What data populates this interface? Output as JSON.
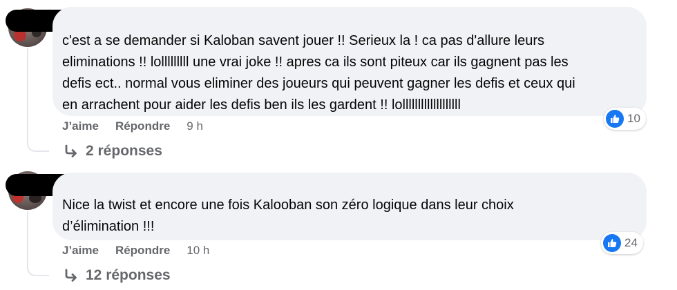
{
  "comments": [
    {
      "text_lines": [
        "c'est a se demander si Kaloban savent jouer !! Serieux la ! ca pas d'allure leurs",
        "eliminations !! lolllllllll une vrai joke !! apres ca ils sont piteux car ils gagnent pas les",
        "defis ect.. normal vous eliminer des joueurs qui peuvent gagner les defis et ceux qui",
        "en arrachent pour aider les defis ben ils les gardent !! lolllllllllllllllllll"
      ],
      "like_label": "J’aime",
      "reply_label": "Répondre",
      "time": "9 h",
      "reaction_count": "10",
      "replies_label": "2 réponses"
    },
    {
      "text_lines": [
        "Nice la twist et encore une fois Kalooban son zéro logique dans leur choix",
        "d’élimination !!!"
      ],
      "like_label": "J’aime",
      "reply_label": "Répondre",
      "time": "10 h",
      "reaction_count": "24",
      "replies_label": "12 réponses"
    }
  ],
  "colors": {
    "bubble_bg": "#f0f2f5",
    "secondary_text": "#65676b",
    "like_blue": "#1877f2",
    "redaction": "#000000"
  },
  "icons": {
    "reaction": "like-thumbs-up-icon",
    "reply": "reply-arrow-icon"
  }
}
